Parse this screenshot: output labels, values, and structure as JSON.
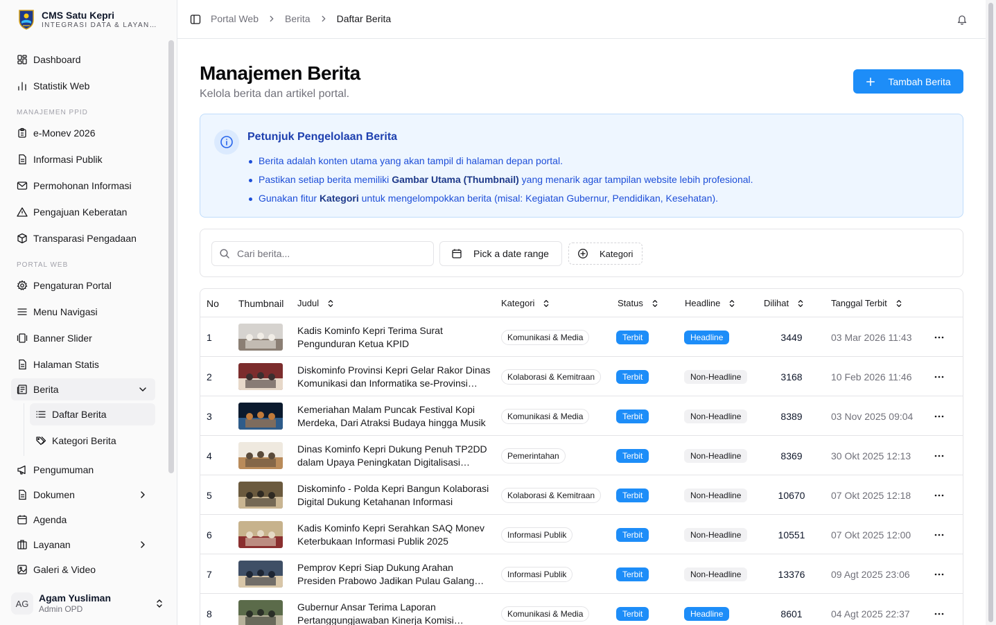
{
  "brand": {
    "title": "CMS Satu Kepri",
    "subtitle": "INTEGRASI DATA & LAYANAN"
  },
  "sidebar": {
    "top_items": [
      "Dashboard",
      "Statistik Web"
    ],
    "section_ppid": "MANAJEMEN PPID",
    "ppid_items": [
      "e-Monev 2026",
      "Informasi Publik",
      "Permohonan Informasi",
      "Pengajuan Keberatan",
      "Transparasi Pengadaan"
    ],
    "section_portal": "PORTAL WEB",
    "portal_items": [
      "Pengaturan Portal",
      "Menu Navigasi",
      "Banner Slider",
      "Halaman Statis"
    ],
    "berita": "Berita",
    "berita_sub": [
      "Daftar Berita",
      "Kategori Berita"
    ],
    "more_items": [
      "Pengumuman",
      "Dokumen",
      "Agenda",
      "Layanan",
      "Galeri & Video"
    ]
  },
  "user": {
    "initials": "AG",
    "name": "Agam Yusliman",
    "role": "Admin OPD"
  },
  "breadcrumb": [
    "Portal Web",
    "Berita",
    "Daftar Berita"
  ],
  "page": {
    "title": "Manajemen Berita",
    "subtitle": "Kelola berita dan artikel portal.",
    "add_button": "Tambah Berita"
  },
  "info": {
    "title": "Petunjuk Pengelolaan Berita",
    "line1": "Berita adalah konten utama yang akan tampil di halaman depan portal.",
    "line2_pre": "Pastikan setiap berita memiliki ",
    "line2_bold": "Gambar Utama (Thumbnail)",
    "line2_post": " yang menarik agar tampilan website lebih profesional.",
    "line3_pre": "Gunakan fitur ",
    "line3_bold": "Kategori",
    "line3_post": " untuk mengelompokkan berita (misal: Kegiatan Gubernur, Pendidikan, Kesehatan)."
  },
  "filters": {
    "search_placeholder": "Cari berita...",
    "date_range": "Pick a date range",
    "category": "Kategori"
  },
  "table": {
    "headers": {
      "no": "No",
      "thumbnail": "Thumbnail",
      "judul": "Judul",
      "kategori": "Kategori",
      "status": "Status",
      "headline": "Headline",
      "dilihat": "Dilihat",
      "tanggal": "Tanggal Terbit"
    },
    "rows": [
      {
        "no": "1",
        "judul": "Kadis Kominfo Kepri Terima Surat Pengunduran Ketua KPID",
        "kategori": "Komunikasi & Media",
        "status": "Terbit",
        "headline": "Headline",
        "dilihat": "3449",
        "tanggal": "03 Mar 2026 11:43"
      },
      {
        "no": "2",
        "judul": "Diskominfo Provinsi Kepri Gelar Rakor Dinas Komunikasi dan Informatika se-Provinsi Kepri",
        "kategori": "Kolaborasi & Kemitraan",
        "status": "Terbit",
        "headline": "Non-Headline",
        "dilihat": "3168",
        "tanggal": "10 Feb 2026 11:46"
      },
      {
        "no": "3",
        "judul": "Kemeriahan Malam Puncak Festival Kopi Merdeka, Dari Atraksi Budaya hingga Musik",
        "kategori": "Komunikasi & Media",
        "status": "Terbit",
        "headline": "Non-Headline",
        "dilihat": "8389",
        "tanggal": "03 Nov 2025 09:04"
      },
      {
        "no": "4",
        "judul": "Dinas Kominfo Kepri Dukung Penuh TP2DD dalam Upaya Peningkatan Digitalisasi Daerah",
        "kategori": "Pemerintahan",
        "status": "Terbit",
        "headline": "Non-Headline",
        "dilihat": "8369",
        "tanggal": "30 Okt 2025 12:13"
      },
      {
        "no": "5",
        "judul": "Diskominfo - Polda Kepri Bangun Kolaborasi Digital Dukung Ketahanan Informasi",
        "kategori": "Kolaborasi & Kemitraan",
        "status": "Terbit",
        "headline": "Non-Headline",
        "dilihat": "10670",
        "tanggal": "07 Okt 2025 12:18"
      },
      {
        "no": "6",
        "judul": "Kadis Kominfo Kepri Serahkan SAQ Monev Keterbukaan Informasi Publik 2025",
        "kategori": "Informasi Publik",
        "status": "Terbit",
        "headline": "Non-Headline",
        "dilihat": "10551",
        "tanggal": "07 Okt 2025 12:00"
      },
      {
        "no": "7",
        "judul": "Pemprov Kepri Siap Dukung Arahan Presiden Prabowo Jadikan Pulau Galang Kawasan",
        "kategori": "Informasi Publik",
        "status": "Terbit",
        "headline": "Non-Headline",
        "dilihat": "13376",
        "tanggal": "09 Agt 2025 23:06"
      },
      {
        "no": "8",
        "judul": "Gubernur Ansar Terima Laporan Pertanggungjawaban Kinerja Komisi Informasi",
        "kategori": "Komunikasi & Media",
        "status": "Terbit",
        "headline": "Headline",
        "dilihat": "8601",
        "tanggal": "04 Agt 2025 22:37"
      }
    ]
  },
  "colors": {
    "accent": "#1d8df8",
    "info_bg": "#eef6ff",
    "info_text": "#1d4ed8"
  }
}
